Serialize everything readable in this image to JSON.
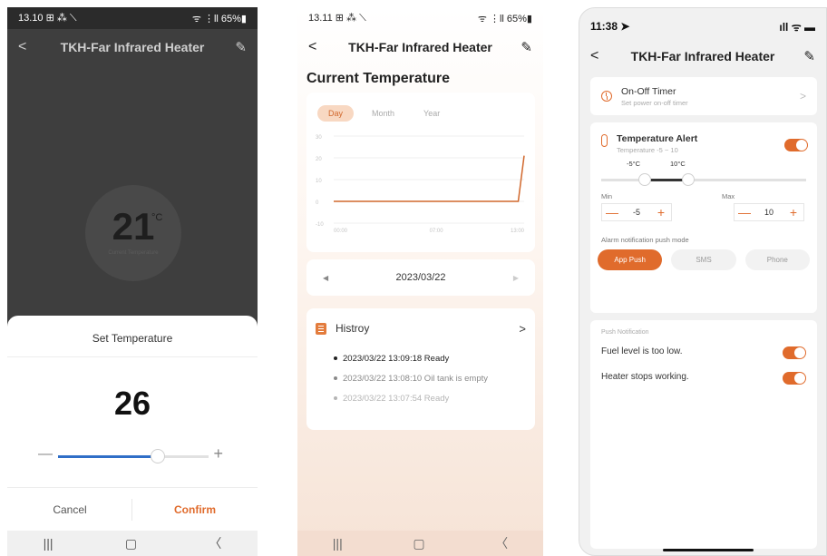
{
  "screen1": {
    "status": {
      "time": "13.10",
      "icons": "⊞ ⁂ ⟍",
      "right": "ᯤ ⋮ll 65%▮"
    },
    "nav": {
      "title": "TKH-Far Infrared Heater"
    },
    "current": {
      "temp": "21",
      "unit": "°C",
      "caption": "Current Temperature"
    },
    "sheet": {
      "title": "Set Temperature",
      "value": "26",
      "slider_fraction": 0.66,
      "cancel": "Cancel",
      "confirm": "Confirm"
    },
    "sysnav": {
      "recent": "|||",
      "home": "▢",
      "back": "〈"
    }
  },
  "screen2": {
    "status": {
      "time": "13.11",
      "icons": "⊞ ⁂ ⟍",
      "right": "ᯤ ⋮ll 65%▮"
    },
    "nav": {
      "title": "TKH-Far Infrared Heater"
    },
    "heading": "Current Temperature",
    "tabs": [
      {
        "label": "Day"
      },
      {
        "label": "Month"
      },
      {
        "label": "Year"
      }
    ],
    "chart_data": {
      "type": "line",
      "title": "",
      "x_ticks": [
        "00:00",
        "07:00",
        "13:00"
      ],
      "y_ticks": [
        "30",
        "20",
        "10",
        "0",
        "-10"
      ],
      "ylim": [
        -10,
        30
      ],
      "xlim": [
        0,
        13
      ],
      "grid": true,
      "color": "#d1682d",
      "series": [
        {
          "x": [
            0,
            12.6,
            13
          ],
          "y": [
            0,
            0,
            21
          ]
        }
      ]
    },
    "date": {
      "prev": "◀",
      "value": "2023/03/22",
      "next": "▶"
    },
    "history": {
      "title": "Histroy",
      "items": [
        {
          "text": "2023/03/22 13:09:18 Ready",
          "color": "#222222"
        },
        {
          "text": "2023/03/22 13:08:10 Oil tank is empty",
          "color": "#8a8a8a"
        },
        {
          "text": "2023/03/22 13:07:54 Ready",
          "color": "#b5b5b5"
        }
      ]
    },
    "sysnav": {
      "recent": "|||",
      "home": "▢",
      "back": "〈"
    }
  },
  "screen3": {
    "status": {
      "time": "11:38 ➤",
      "right": "ıll ᯤ ▬"
    },
    "nav": {
      "title": "TKH-Far Infrared Heater"
    },
    "timer": {
      "title": "On-Off Timer",
      "subtitle": "Set power on-off timer"
    },
    "alert": {
      "title": "Temperature Alert",
      "subtitle": "Temperature -5 ~ 10",
      "enabled": true,
      "min_label_top": "-5°C",
      "max_label_top": "10°C",
      "min_label": "Min",
      "max_label": "Max",
      "min_value": "-5",
      "max_value": "10",
      "minus": "—",
      "plus": "+",
      "push_mode_label": "Alarm notification push mode",
      "modes": [
        {
          "label": "App Push"
        },
        {
          "label": "SMS"
        },
        {
          "label": "Phone"
        }
      ]
    },
    "push": {
      "caption": "Push Notification",
      "items": [
        {
          "label": "Fuel level is too low.",
          "enabled": true
        },
        {
          "label": "Heater stops working.",
          "enabled": true
        }
      ]
    }
  }
}
